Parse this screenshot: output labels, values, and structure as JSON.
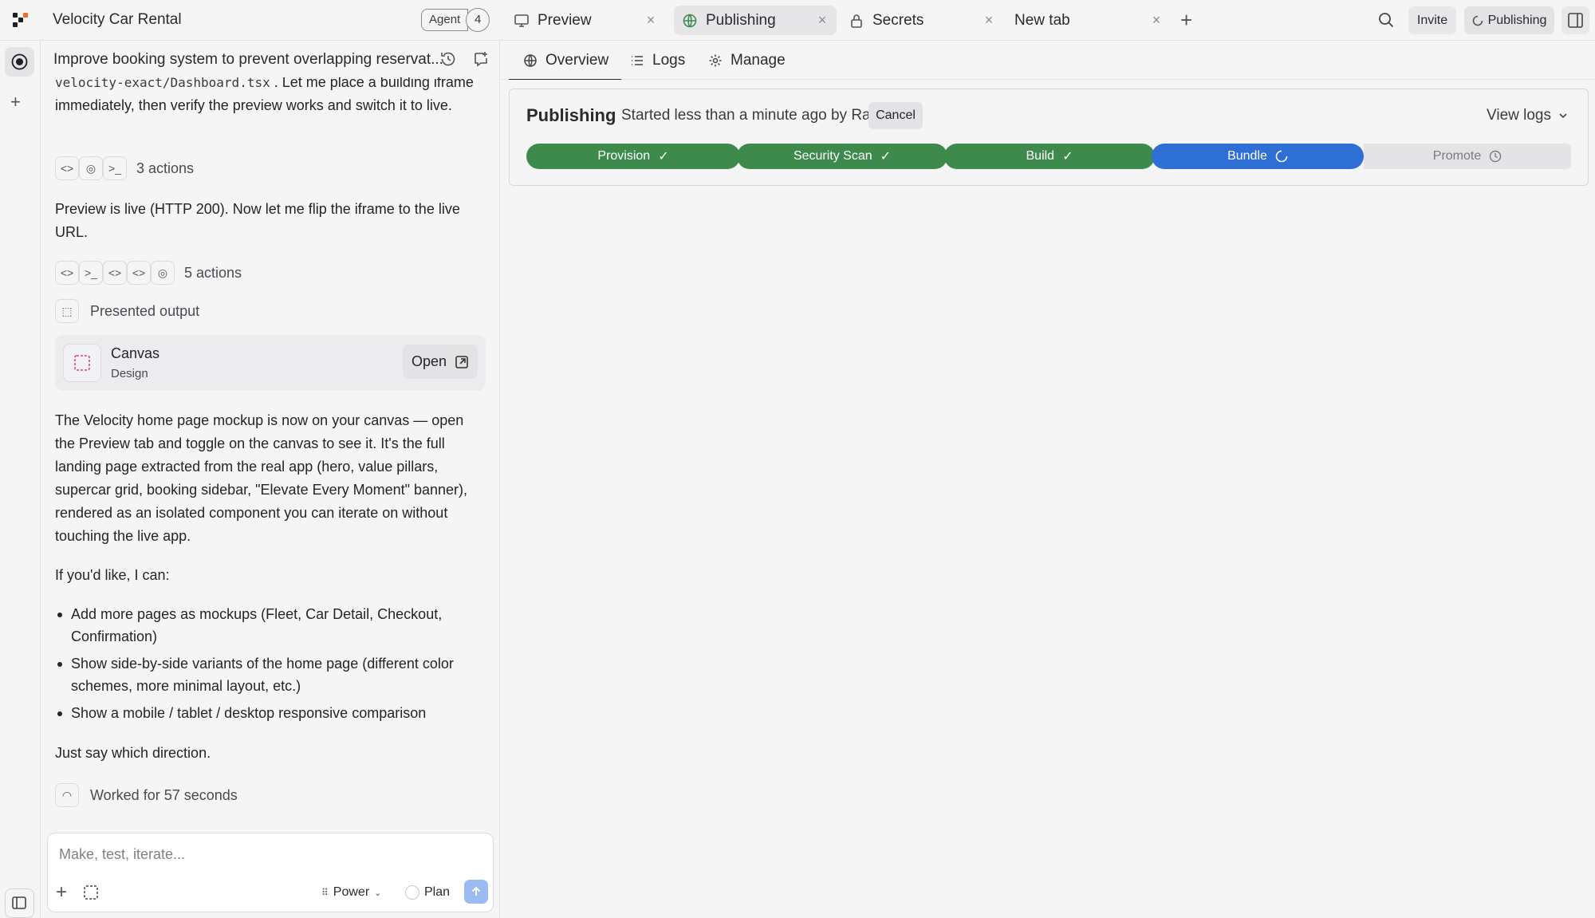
{
  "project_title": "Velocity Car Rental",
  "agent": {
    "label": "Agent",
    "count": "4"
  },
  "tabs": [
    {
      "label": "Preview",
      "icon": "monitor-icon"
    },
    {
      "label": "Publishing",
      "icon": "globe-icon"
    },
    {
      "label": "Secrets",
      "icon": "lock-icon"
    },
    {
      "label": "New tab",
      "icon": ""
    }
  ],
  "header": {
    "invite_label": "Invite",
    "publishing_label": "Publishing"
  },
  "chat": {
    "title": "Improve booking system to prevent overlapping reservat...",
    "msg1_code": "velocity-exact/Dashboard.tsx",
    "msg1_text_a": ". Let me place a building",
    "msg1_text_b": "iframe immediately, then verify the preview works and switch it to live.",
    "actions1_label": "3 actions",
    "msg2_text": "Preview is live (HTTP 200). Now let me flip the iframe to the live URL.",
    "actions2_label": "5 actions",
    "presented_label": "Presented output",
    "card": {
      "title": "Canvas",
      "subtitle": "Design",
      "open_label": "Open"
    },
    "msg3_text": "The Velocity home page mockup is now on your canvas — open the Preview tab and toggle on the canvas to see it. It's the full landing page extracted from the real app (hero, value pillars, supercar grid, booking sidebar, \"Elevate Every Moment\" banner), rendered as an isolated component you can iterate on without touching the live app.",
    "msg4_text": "If you'd like, I can:",
    "bullets": [
      "Add more pages as mockups (Fleet, Car Detail, Checkout, Confirmation)",
      "Show side-by-side variants of the home page (different color schemes, more minimal layout, etc.)",
      "Show a mobile / tablet / desktop responsive comparison"
    ],
    "msg5_text": "Just say which direction.",
    "worked_label": "Worked for 57 seconds"
  },
  "composer": {
    "placeholder": "Make, test, iterate...",
    "power_label": "Power",
    "plan_label": "Plan"
  },
  "subtabs": [
    {
      "label": "Overview"
    },
    {
      "label": "Logs"
    },
    {
      "label": "Manage"
    }
  ],
  "publishing": {
    "title": "Publishing",
    "meta": "Started less than a minute ago by Raouf",
    "cancel_label": "Cancel",
    "view_logs_label": "View logs",
    "steps": [
      {
        "label": "Provision",
        "status": "done"
      },
      {
        "label": "Security Scan",
        "status": "done"
      },
      {
        "label": "Build",
        "status": "done"
      },
      {
        "label": "Bundle",
        "status": "in-progress"
      },
      {
        "label": "Promote",
        "status": "pending"
      }
    ]
  },
  "colors": {
    "step_done": "#3e8a4c",
    "step_active": "#2e6fd6",
    "step_pending": "#e4e4e7",
    "send_button": "#9bbcf2"
  }
}
